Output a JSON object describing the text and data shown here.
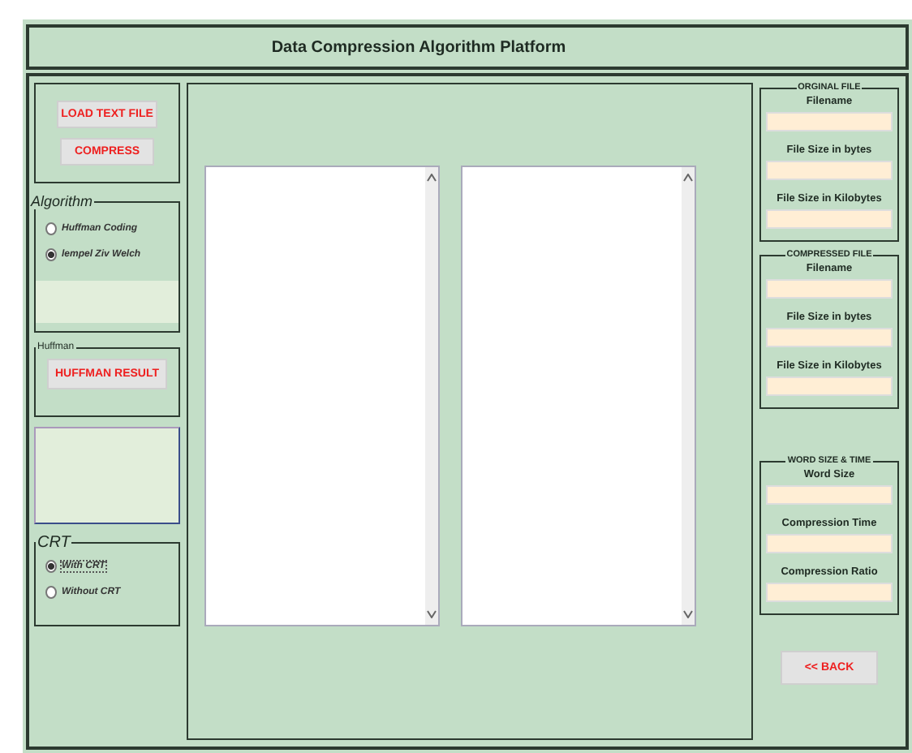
{
  "window": {
    "title": "Data Compression Algorithm Platform"
  },
  "file_buttons": [
    "LOAD TEXT FILE",
    "COMPRESS"
  ],
  "algorithm": {
    "legend": "Algorithm",
    "options": [
      {
        "label": "Huffman Coding",
        "selected": false
      },
      {
        "label": "lempel Ziv Welch",
        "selected": true
      }
    ]
  },
  "huffman": {
    "legend": "Huffman",
    "button": "HUFFMAN RESULT"
  },
  "crt": {
    "legend": "CRT",
    "options": [
      {
        "label": "With CRT",
        "selected": true
      },
      {
        "label": "Without CRT",
        "selected": false
      }
    ]
  },
  "right_groups": [
    {
      "legend": "ORGINAL FILE",
      "fields": [
        "Filename",
        "File Size in bytes",
        "File Size in Kilobytes"
      ]
    },
    {
      "legend": "COMPRESSED FILE",
      "fields": [
        "Filename",
        "File Size in bytes",
        "File Size in Kilobytes"
      ]
    },
    {
      "legend": "WORD SIZE & TIME",
      "fields": [
        "Word Size",
        "Compression Time",
        "Compression Ratio"
      ]
    }
  ],
  "back_button": "<< BACK"
}
